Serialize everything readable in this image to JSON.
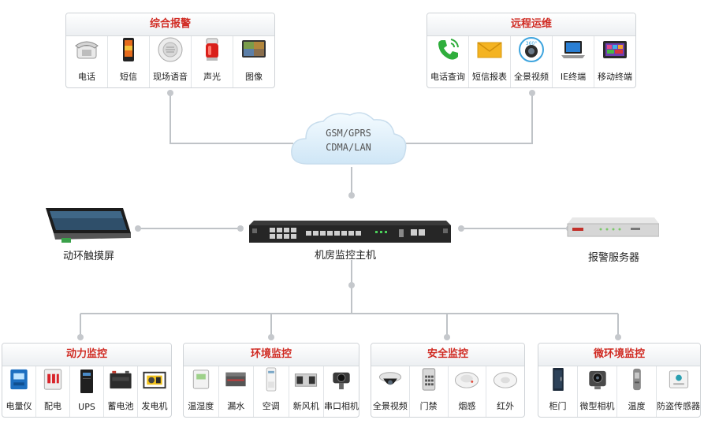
{
  "top_panels": [
    {
      "title": "综合报警",
      "items": [
        {
          "label": "电话",
          "icon": "telephone-icon"
        },
        {
          "label": "短信",
          "icon": "mobile-phone-icon"
        },
        {
          "label": "现场语音",
          "icon": "speaker-icon"
        },
        {
          "label": "声光",
          "icon": "alarm-light-icon"
        },
        {
          "label": "图像",
          "icon": "monitor-image-icon"
        }
      ]
    },
    {
      "title": "远程运维",
      "items": [
        {
          "label": "电话查询",
          "icon": "phone-call-icon"
        },
        {
          "label": "短信报表",
          "icon": "envelope-icon"
        },
        {
          "label": "全景视频",
          "icon": "camera-360-icon"
        },
        {
          "label": "IE终端",
          "icon": "laptop-icon"
        },
        {
          "label": "移动终端",
          "icon": "tablet-icon"
        }
      ]
    }
  ],
  "network": {
    "line1": "GSM/GPRS",
    "line2": "CDMA/LAN"
  },
  "nodes": {
    "touch_screen": "动环触摸屏",
    "host": "机房监控主机",
    "alarm_server": "报警服务器"
  },
  "bottom_panels": [
    {
      "title": "动力监控",
      "items": [
        {
          "label": "电量仪",
          "icon": "power-meter-icon"
        },
        {
          "label": "配电",
          "icon": "circuit-breaker-icon"
        },
        {
          "label": "UPS",
          "icon": "ups-icon"
        },
        {
          "label": "蓄电池",
          "icon": "battery-icon"
        },
        {
          "label": "发电机",
          "icon": "generator-icon"
        }
      ]
    },
    {
      "title": "环境监控",
      "items": [
        {
          "label": "温湿度",
          "icon": "thermo-hygrometer-icon"
        },
        {
          "label": "漏水",
          "icon": "water-leak-sensor-icon"
        },
        {
          "label": "空调",
          "icon": "air-conditioner-icon"
        },
        {
          "label": "新风机",
          "icon": "fresh-air-unit-icon"
        },
        {
          "label": "串口相机",
          "icon": "serial-camera-icon"
        }
      ]
    },
    {
      "title": "安全监控",
      "items": [
        {
          "label": "全景视频",
          "icon": "dome-camera-icon"
        },
        {
          "label": "门禁",
          "icon": "access-keypad-icon"
        },
        {
          "label": "烟感",
          "icon": "smoke-detector-icon"
        },
        {
          "label": "红外",
          "icon": "infrared-detector-icon"
        }
      ]
    },
    {
      "title": "微环境监控",
      "items": [
        {
          "label": "柜门",
          "icon": "cabinet-icon"
        },
        {
          "label": "微型相机",
          "icon": "mini-camera-icon"
        },
        {
          "label": "温度",
          "icon": "temperature-sensor-icon"
        },
        {
          "label": "防盗传感器",
          "icon": "anti-theft-sensor-icon"
        }
      ]
    }
  ],
  "colors": {
    "panel_title": "#d02a22",
    "wire": "#bfc3c7"
  }
}
